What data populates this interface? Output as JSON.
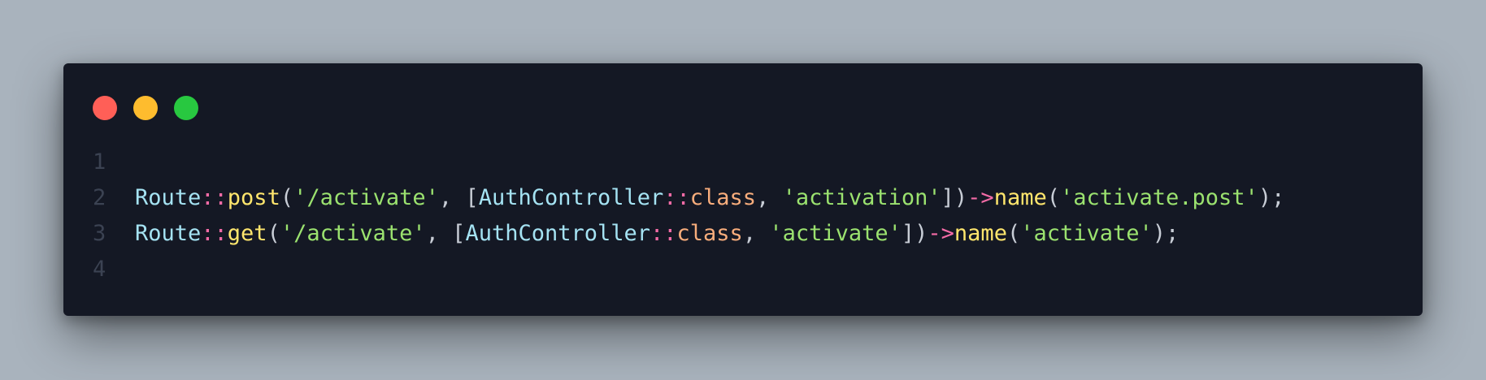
{
  "window": {
    "background": "#141824",
    "controls": [
      {
        "name": "close-dot",
        "color": "#ff5f57"
      },
      {
        "name": "minimize-dot",
        "color": "#febc2e"
      },
      {
        "name": "maximize-dot",
        "color": "#28c840"
      }
    ]
  },
  "colors": {
    "class": "#a5e3f3",
    "operator": "#f36ba6",
    "method": "#ffe66d",
    "punct": "#c8cdd6",
    "string": "#9be26f",
    "keyword": "#f8ad7c",
    "linenumber": "#3b4252"
  },
  "code": {
    "lines": [
      {
        "number": "1",
        "tokens": []
      },
      {
        "number": "2",
        "tokens": [
          {
            "t": "Route",
            "k": "class"
          },
          {
            "t": "::",
            "k": "operator"
          },
          {
            "t": "post",
            "k": "method"
          },
          {
            "t": "(",
            "k": "punct"
          },
          {
            "t": "'/activate'",
            "k": "string"
          },
          {
            "t": ", [",
            "k": "punct"
          },
          {
            "t": "AuthController",
            "k": "class"
          },
          {
            "t": "::",
            "k": "operator"
          },
          {
            "t": "class",
            "k": "keyword"
          },
          {
            "t": ", ",
            "k": "punct"
          },
          {
            "t": "'activation'",
            "k": "string"
          },
          {
            "t": "])",
            "k": "punct"
          },
          {
            "t": "->",
            "k": "operator"
          },
          {
            "t": "name",
            "k": "method"
          },
          {
            "t": "(",
            "k": "punct"
          },
          {
            "t": "'activate.post'",
            "k": "string"
          },
          {
            "t": ");",
            "k": "punct"
          }
        ]
      },
      {
        "number": "3",
        "tokens": [
          {
            "t": "Route",
            "k": "class"
          },
          {
            "t": "::",
            "k": "operator"
          },
          {
            "t": "get",
            "k": "method"
          },
          {
            "t": "(",
            "k": "punct"
          },
          {
            "t": "'/activate'",
            "k": "string"
          },
          {
            "t": ", [",
            "k": "punct"
          },
          {
            "t": "AuthController",
            "k": "class"
          },
          {
            "t": "::",
            "k": "operator"
          },
          {
            "t": "class",
            "k": "keyword"
          },
          {
            "t": ", ",
            "k": "punct"
          },
          {
            "t": "'activate'",
            "k": "string"
          },
          {
            "t": "])",
            "k": "punct"
          },
          {
            "t": "->",
            "k": "operator"
          },
          {
            "t": "name",
            "k": "method"
          },
          {
            "t": "(",
            "k": "punct"
          },
          {
            "t": "'activate'",
            "k": "string"
          },
          {
            "t": ");",
            "k": "punct"
          }
        ]
      },
      {
        "number": "4",
        "tokens": []
      }
    ]
  }
}
